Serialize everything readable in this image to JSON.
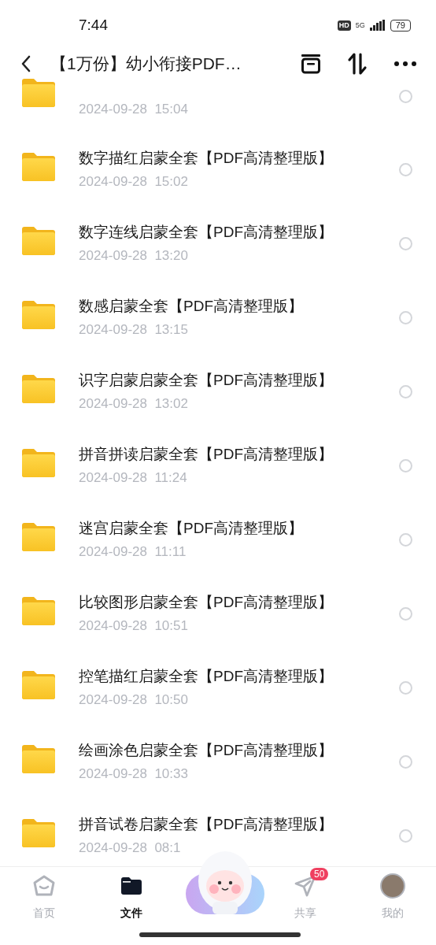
{
  "status_bar": {
    "time": "7:44",
    "hd": "HD",
    "network": "5G",
    "battery": "79"
  },
  "header": {
    "title": "【1万份】幼小衔接PDF…"
  },
  "files": [
    {
      "kind": "partial",
      "date": "2024-09-28  15:04",
      "selected": false
    },
    {
      "kind": "folder",
      "name": "数字描红启蒙全套【PDF高清整理版】",
      "date": "2024-09-28  15:02",
      "selected": false
    },
    {
      "kind": "folder",
      "name": "数字连线启蒙全套【PDF高清整理版】",
      "date": "2024-09-28  13:20",
      "selected": false
    },
    {
      "kind": "folder",
      "name": "数感启蒙全套【PDF高清整理版】",
      "date": "2024-09-28  13:15",
      "selected": false
    },
    {
      "kind": "folder",
      "name": "识字启蒙启蒙全套【PDF高清整理版】",
      "date": "2024-09-28  13:02",
      "selected": false
    },
    {
      "kind": "folder",
      "name": "拼音拼读启蒙全套【PDF高清整理版】",
      "date": "2024-09-28  11:24",
      "selected": false
    },
    {
      "kind": "folder",
      "name": "迷宫启蒙全套【PDF高清整理版】",
      "date": "2024-09-28  11:11",
      "selected": false
    },
    {
      "kind": "folder",
      "name": "比较图形启蒙全套【PDF高清整理版】",
      "date": "2024-09-28  10:51",
      "selected": false
    },
    {
      "kind": "folder",
      "name": "控笔描红启蒙全套【PDF高清整理版】",
      "date": "2024-09-28  10:50",
      "selected": false
    },
    {
      "kind": "folder",
      "name": "绘画涂色启蒙全套【PDF高清整理版】",
      "date": "2024-09-28  10:33",
      "selected": false
    },
    {
      "kind": "folder",
      "name": "拼音试卷启蒙全套【PDF高清整理版】",
      "date": "2024-09-28  08:1",
      "selected": false
    }
  ],
  "nav": [
    {
      "kind": "home",
      "label": "首页",
      "selected": false
    },
    {
      "kind": "files",
      "label": "文件",
      "selected": true
    },
    {
      "kind": "mascot"
    },
    {
      "kind": "share",
      "label": "共享",
      "badge": "50",
      "selected": false
    },
    {
      "kind": "me",
      "label": "我的",
      "selected": false
    }
  ]
}
